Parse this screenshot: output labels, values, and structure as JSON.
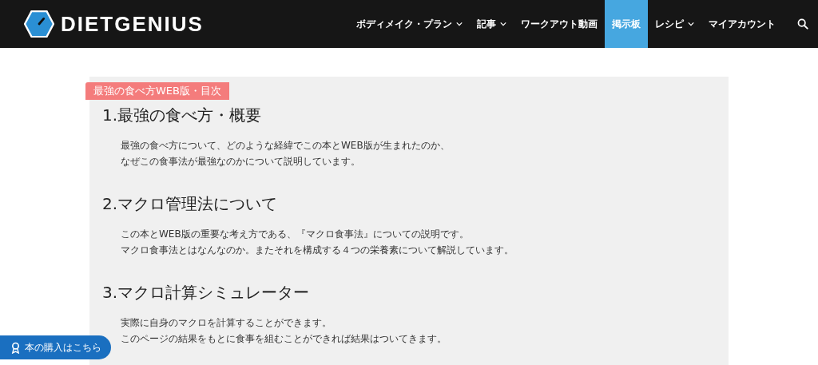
{
  "header": {
    "logo": "DIETGENIUS",
    "nav": [
      {
        "label": "ボディメイク・プラン",
        "has_menu": true,
        "selected": false
      },
      {
        "label": "記事",
        "has_menu": true,
        "selected": false
      },
      {
        "label": "ワークアウト動画",
        "has_menu": false,
        "selected": false
      },
      {
        "label": "掲示板",
        "has_menu": false,
        "selected": true
      },
      {
        "label": "レシピ",
        "has_menu": true,
        "selected": false
      },
      {
        "label": "マイアカウント",
        "has_menu": false,
        "selected": false
      }
    ]
  },
  "toc": {
    "tag": "最強の食べ方WEB版・目次",
    "sections": [
      {
        "heading": "1.最強の食べ方・概要",
        "lines": [
          "最強の食べ方について、どのような経緯でこの本とWEB版が生まれたのか、",
          "なぜこの食事法が最強なのかについて説明しています。"
        ]
      },
      {
        "heading": "2.マクロ管理法について",
        "lines": [
          "この本とWEB版の重要な考え方である、『マクロ食事法』についての説明です。",
          "マクロ食事法とはなんなのか。またそれを構成する４つの栄養素について解説しています。"
        ]
      },
      {
        "heading": "3.マクロ計算シミュレーター",
        "lines": [
          "実際に自身のマクロを計算することができます。",
          "このページの結果をもとに食事を組むことができれば結果はついてきます。"
        ]
      }
    ]
  },
  "floating_button": {
    "label": "本の購入はこちら"
  }
}
